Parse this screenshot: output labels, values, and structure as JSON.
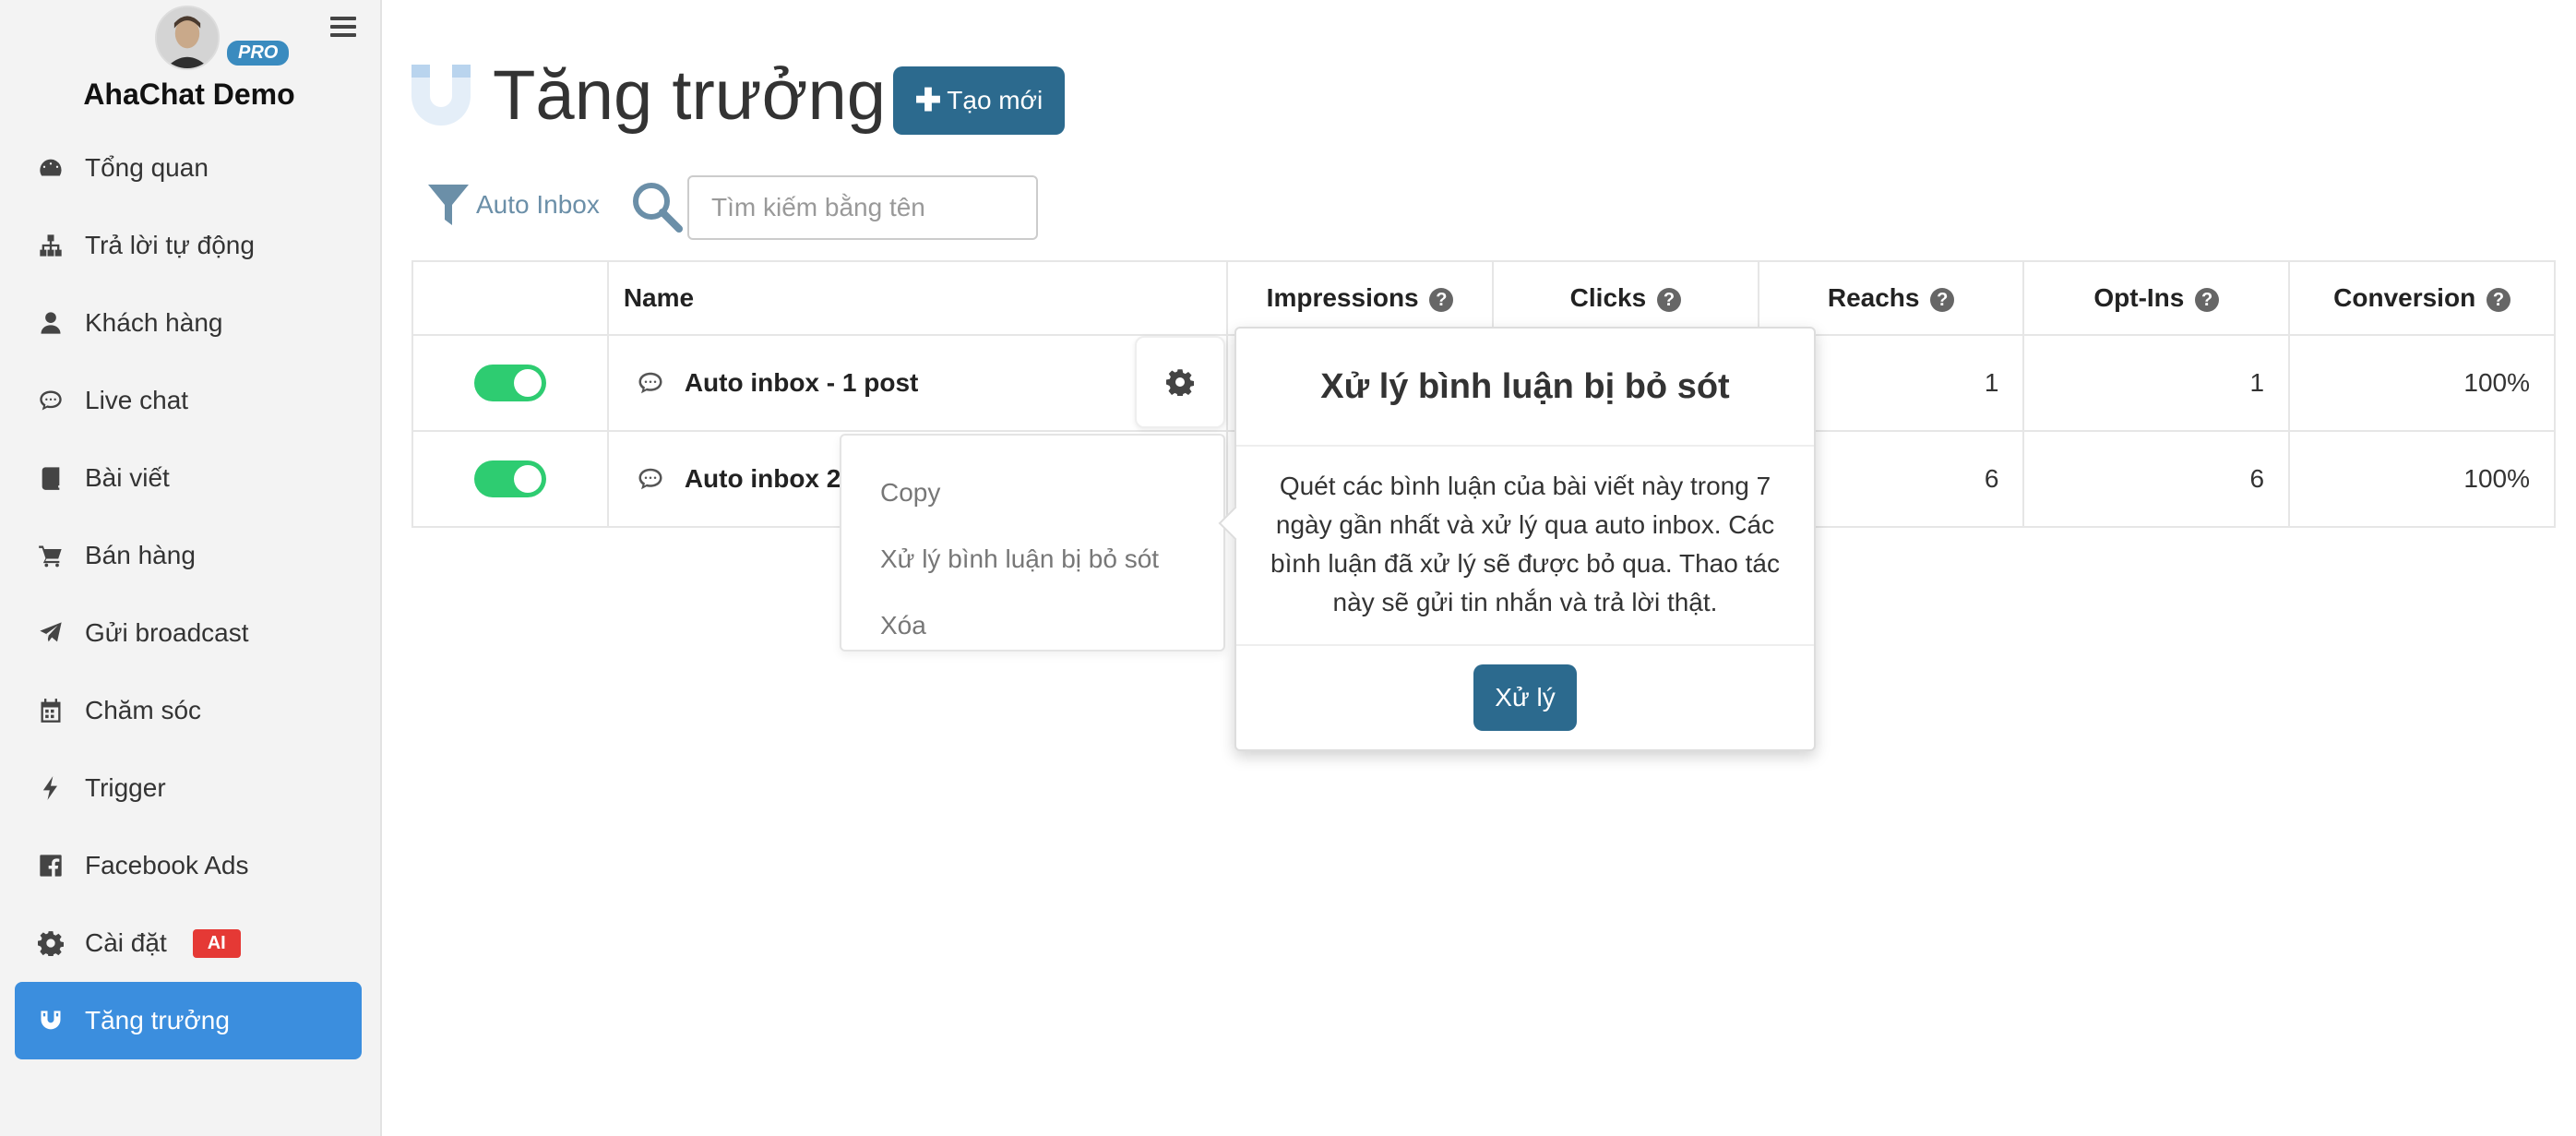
{
  "sidebar": {
    "badge": "PRO",
    "account_name": "AhaChat Demo",
    "items": [
      {
        "label": "Tổng quan",
        "icon": "dashboard-icon"
      },
      {
        "label": "Trả lời tự động",
        "icon": "sitemap-icon"
      },
      {
        "label": "Khách hàng",
        "icon": "user-icon"
      },
      {
        "label": "Live chat",
        "icon": "chat-bubble-icon"
      },
      {
        "label": "Bài viết",
        "icon": "book-icon"
      },
      {
        "label": "Bán hàng",
        "icon": "cart-icon"
      },
      {
        "label": "Gửi broadcast",
        "icon": "paper-plane-icon"
      },
      {
        "label": "Chăm sóc",
        "icon": "calendar-icon"
      },
      {
        "label": "Trigger",
        "icon": "bolt-icon"
      },
      {
        "label": "Facebook Ads",
        "icon": "facebook-icon"
      },
      {
        "label": "Cài đặt",
        "icon": "gear-icon",
        "badge": "AI"
      },
      {
        "label": "Tăng trưởng",
        "icon": "magnet-icon",
        "active": true
      }
    ]
  },
  "header": {
    "title": "Tăng trưởng",
    "create_button": "Tạo mới"
  },
  "filter": {
    "label": "Auto Inbox",
    "search_placeholder": "Tìm kiếm bằng tên"
  },
  "table": {
    "columns": [
      "",
      "Name",
      "Impressions",
      "Clicks",
      "Reachs",
      "Opt-Ins",
      "Conversion"
    ],
    "rows": [
      {
        "enabled": true,
        "name": "Auto inbox - 1 post",
        "impressions": "",
        "clicks": "",
        "reachs": "1",
        "optins": "1",
        "conversion": "100%"
      },
      {
        "enabled": true,
        "name": "Auto inbox 2",
        "impressions": "",
        "clicks": "",
        "reachs": "6",
        "optins": "6",
        "conversion": "100%"
      }
    ]
  },
  "dropdown": {
    "items": [
      "Copy",
      "Xử lý bình luận bị bỏ sót",
      "Xóa"
    ]
  },
  "popover": {
    "title": "Xử lý bình luận bị bỏ sót",
    "body": "Quét các bình luận của bài viết này trong 7 ngày gần nhất và xử lý qua auto inbox. Các bình luận đã xử lý sẽ được bỏ qua. Thao tác này sẽ gửi tin nhắn và trả lời thật.",
    "button": "Xử lý"
  },
  "colors": {
    "accent": "#2c6a8e",
    "active_nav": "#3b8ede",
    "toggle_on": "#2ecc71",
    "ai_badge": "#e53935",
    "pro_badge": "#3a8bbf"
  }
}
